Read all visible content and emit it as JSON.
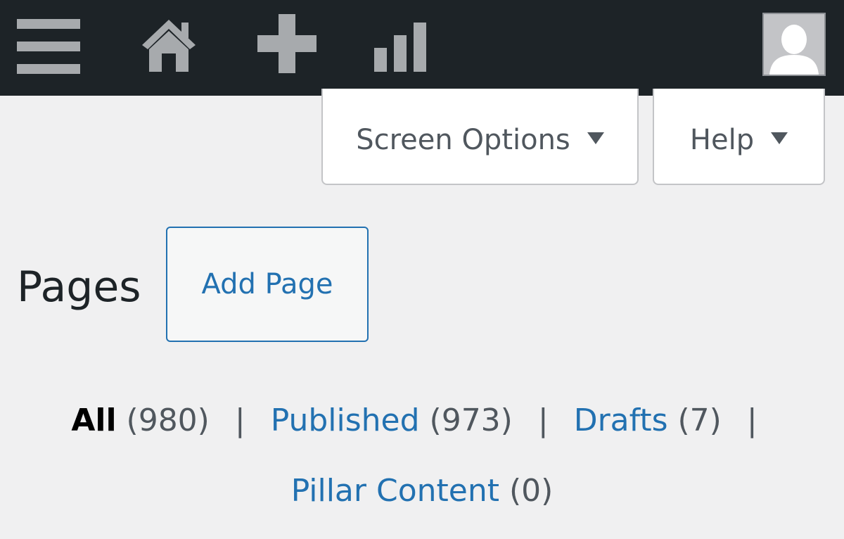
{
  "admin_bar": {
    "icons": {
      "menu": "menu-icon",
      "home": "home-icon",
      "new": "plus-icon",
      "stats": "bar-chart-icon",
      "avatar": "avatar"
    },
    "colors": {
      "background": "#1d2327",
      "icon": "#a7aaad"
    }
  },
  "screen_meta": {
    "screen_options_label": "Screen Options",
    "help_label": "Help"
  },
  "header": {
    "title": "Pages",
    "add_button_label": "Add Page"
  },
  "filters": [
    {
      "label": "All",
      "count": "(980)",
      "current": true
    },
    {
      "label": "Published",
      "count": "(973)",
      "current": false
    },
    {
      "label": "Drafts",
      "count": "(7)",
      "current": false
    },
    {
      "label": "Pillar Content",
      "count": "(0)",
      "current": false
    }
  ],
  "colors": {
    "page_background": "#f0f0f1",
    "link": "#2271b1",
    "muted_text": "#50575e"
  }
}
